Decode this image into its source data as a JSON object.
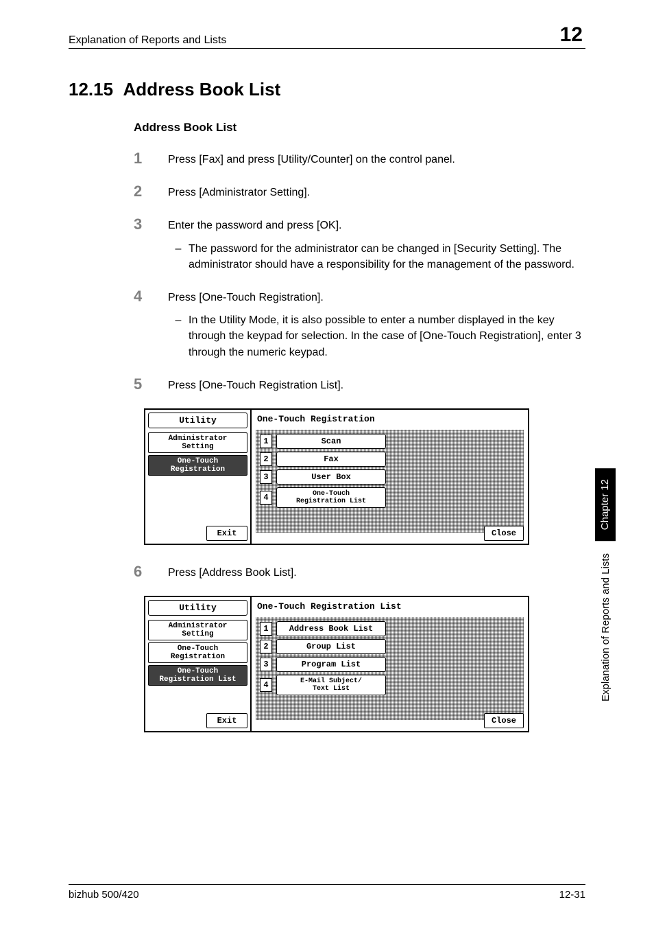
{
  "header": {
    "text": "Explanation of Reports and Lists",
    "chapter_num": "12"
  },
  "section": {
    "number": "12.15",
    "title": "Address Book List"
  },
  "subsection": {
    "title": "Address Book List"
  },
  "steps": [
    {
      "num": "1",
      "text": "Press [Fax] and press [Utility/Counter] on the control panel."
    },
    {
      "num": "2",
      "text": "Press [Administrator Setting]."
    },
    {
      "num": "3",
      "text": "Enter the password and press [OK].",
      "sub": "The password for the administrator can be changed in [Security Setting]. The administrator should have a responsibility for the management of the password."
    },
    {
      "num": "4",
      "text": "Press [One-Touch Registration].",
      "sub": "In the Utility Mode, it is also possible to enter a number displayed in the key through the keypad for selection. In the case of [One-Touch Registration], enter 3 through the numeric keypad."
    },
    {
      "num": "5",
      "text": "Press [One-Touch Registration List]."
    },
    {
      "num": "6",
      "text": "Press [Address Book List]."
    }
  ],
  "ui1": {
    "utility_label": "Utility",
    "nav": [
      "Administrator\nSetting",
      "One-Touch\nRegistration"
    ],
    "exit": "Exit",
    "title": "One-Touch Registration",
    "menu": [
      {
        "num": "1",
        "label": "Scan"
      },
      {
        "num": "2",
        "label": "Fax"
      },
      {
        "num": "3",
        "label": "User Box"
      },
      {
        "num": "4",
        "label": "One-Touch\nRegistration List"
      }
    ],
    "close": "Close"
  },
  "ui2": {
    "utility_label": "Utility",
    "nav": [
      "Administrator\nSetting",
      "One-Touch\nRegistration",
      "One-Touch\nRegistration List"
    ],
    "exit": "Exit",
    "title": "One-Touch Registration List",
    "menu": [
      {
        "num": "1",
        "label": "Address Book List"
      },
      {
        "num": "2",
        "label": "Group List"
      },
      {
        "num": "3",
        "label": "Program List"
      },
      {
        "num": "4",
        "label": "E-Mail Subject/\nText List"
      }
    ],
    "close": "Close"
  },
  "sidetab": {
    "dark": "Chapter 12",
    "light": "Explanation of Reports and Lists"
  },
  "footer": {
    "left": "bizhub 500/420",
    "right": "12-31"
  }
}
